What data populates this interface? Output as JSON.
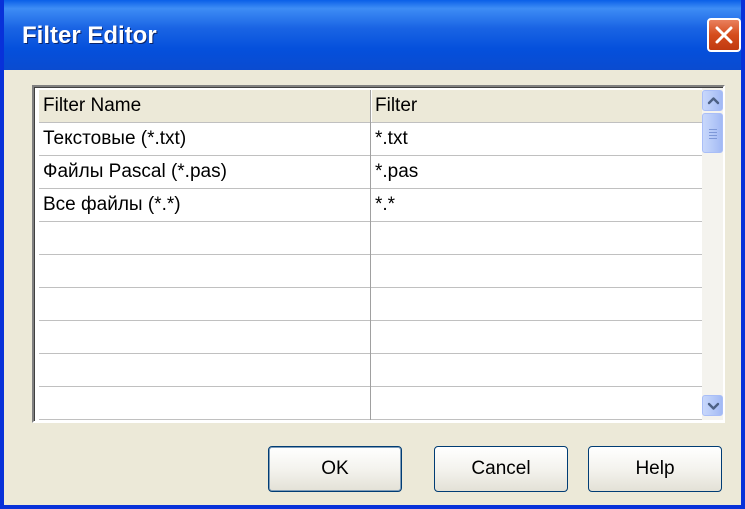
{
  "window": {
    "title": "Filter Editor"
  },
  "table": {
    "headers": [
      "Filter Name",
      "Filter"
    ],
    "rows": [
      [
        "Текстовые (*.txt)",
        "*.txt"
      ],
      [
        "Файлы Pascal (*.pas)",
        "*.pas"
      ],
      [
        "Все файлы (*.*)",
        "*.*"
      ],
      [
        "",
        ""
      ],
      [
        "",
        ""
      ],
      [
        "",
        ""
      ],
      [
        "",
        ""
      ],
      [
        "",
        ""
      ],
      [
        "",
        ""
      ]
    ]
  },
  "buttons": {
    "ok": "OK",
    "cancel": "Cancel",
    "help": "Help"
  },
  "icons": {
    "close": "close-icon",
    "scroll_up": "chevron-up-icon",
    "scroll_down": "chevron-down-icon"
  },
  "colors": {
    "titlebar": "#0A5FE8",
    "close_button": "#D54C1C",
    "dialog_face": "#ECE9D8"
  }
}
